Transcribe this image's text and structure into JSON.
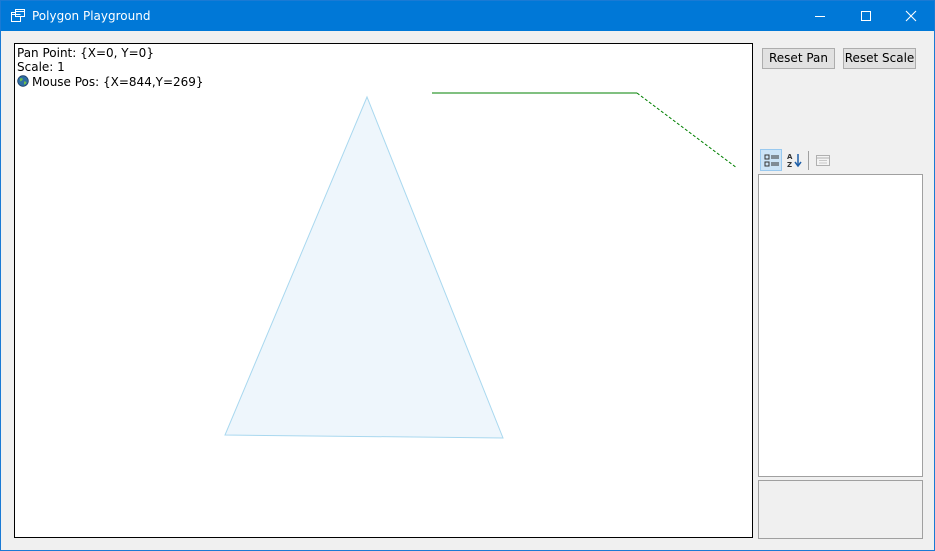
{
  "window": {
    "title": "Polygon Playground",
    "accent_color": "#0078d7",
    "icons": {
      "app": "app-window-icon",
      "minimize": "minimize-icon",
      "maximize": "maximize-icon",
      "close": "close-icon"
    }
  },
  "canvas": {
    "pan_text": "Pan Point: {X=0, Y=0}",
    "scale_text": "Scale: 1",
    "mouse_text": "Mouse Pos: {X=844,Y=269}",
    "mouse_icon": "globe-icon",
    "polygon_fill": "#eef6fc",
    "polygon_stroke": "#a9d8ef",
    "line_color": "#008000"
  },
  "buttons": {
    "reset_pan": "Reset Pan",
    "reset_scale": "Reset Scale"
  },
  "property_grid": {
    "toolbar_icons": [
      "categorized-icon",
      "alphabetical-sort-icon",
      "property-pages-icon"
    ]
  }
}
